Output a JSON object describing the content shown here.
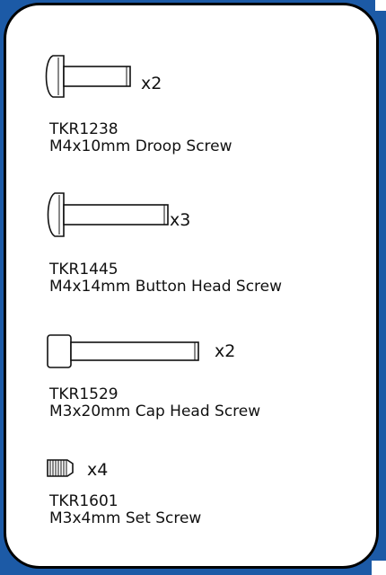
{
  "colors": {
    "frame_blue": "#1c5aa6",
    "card": "#ffffff",
    "ink": "#111111"
  },
  "parts": [
    {
      "icon": "droop-screw-icon",
      "quantity": "x2",
      "code": "TKR1238",
      "description": "M4x10mm Droop Screw"
    },
    {
      "icon": "button-head-screw-icon",
      "quantity": "x3",
      "code": "TKR1445",
      "description": "M4x14mm Button Head Screw"
    },
    {
      "icon": "cap-head-screw-icon",
      "quantity": "x2",
      "code": "TKR1529",
      "description": "M3x20mm Cap Head Screw"
    },
    {
      "icon": "set-screw-icon",
      "quantity": "x4",
      "code": "TKR1601",
      "description": "M3x4mm Set Screw"
    }
  ]
}
